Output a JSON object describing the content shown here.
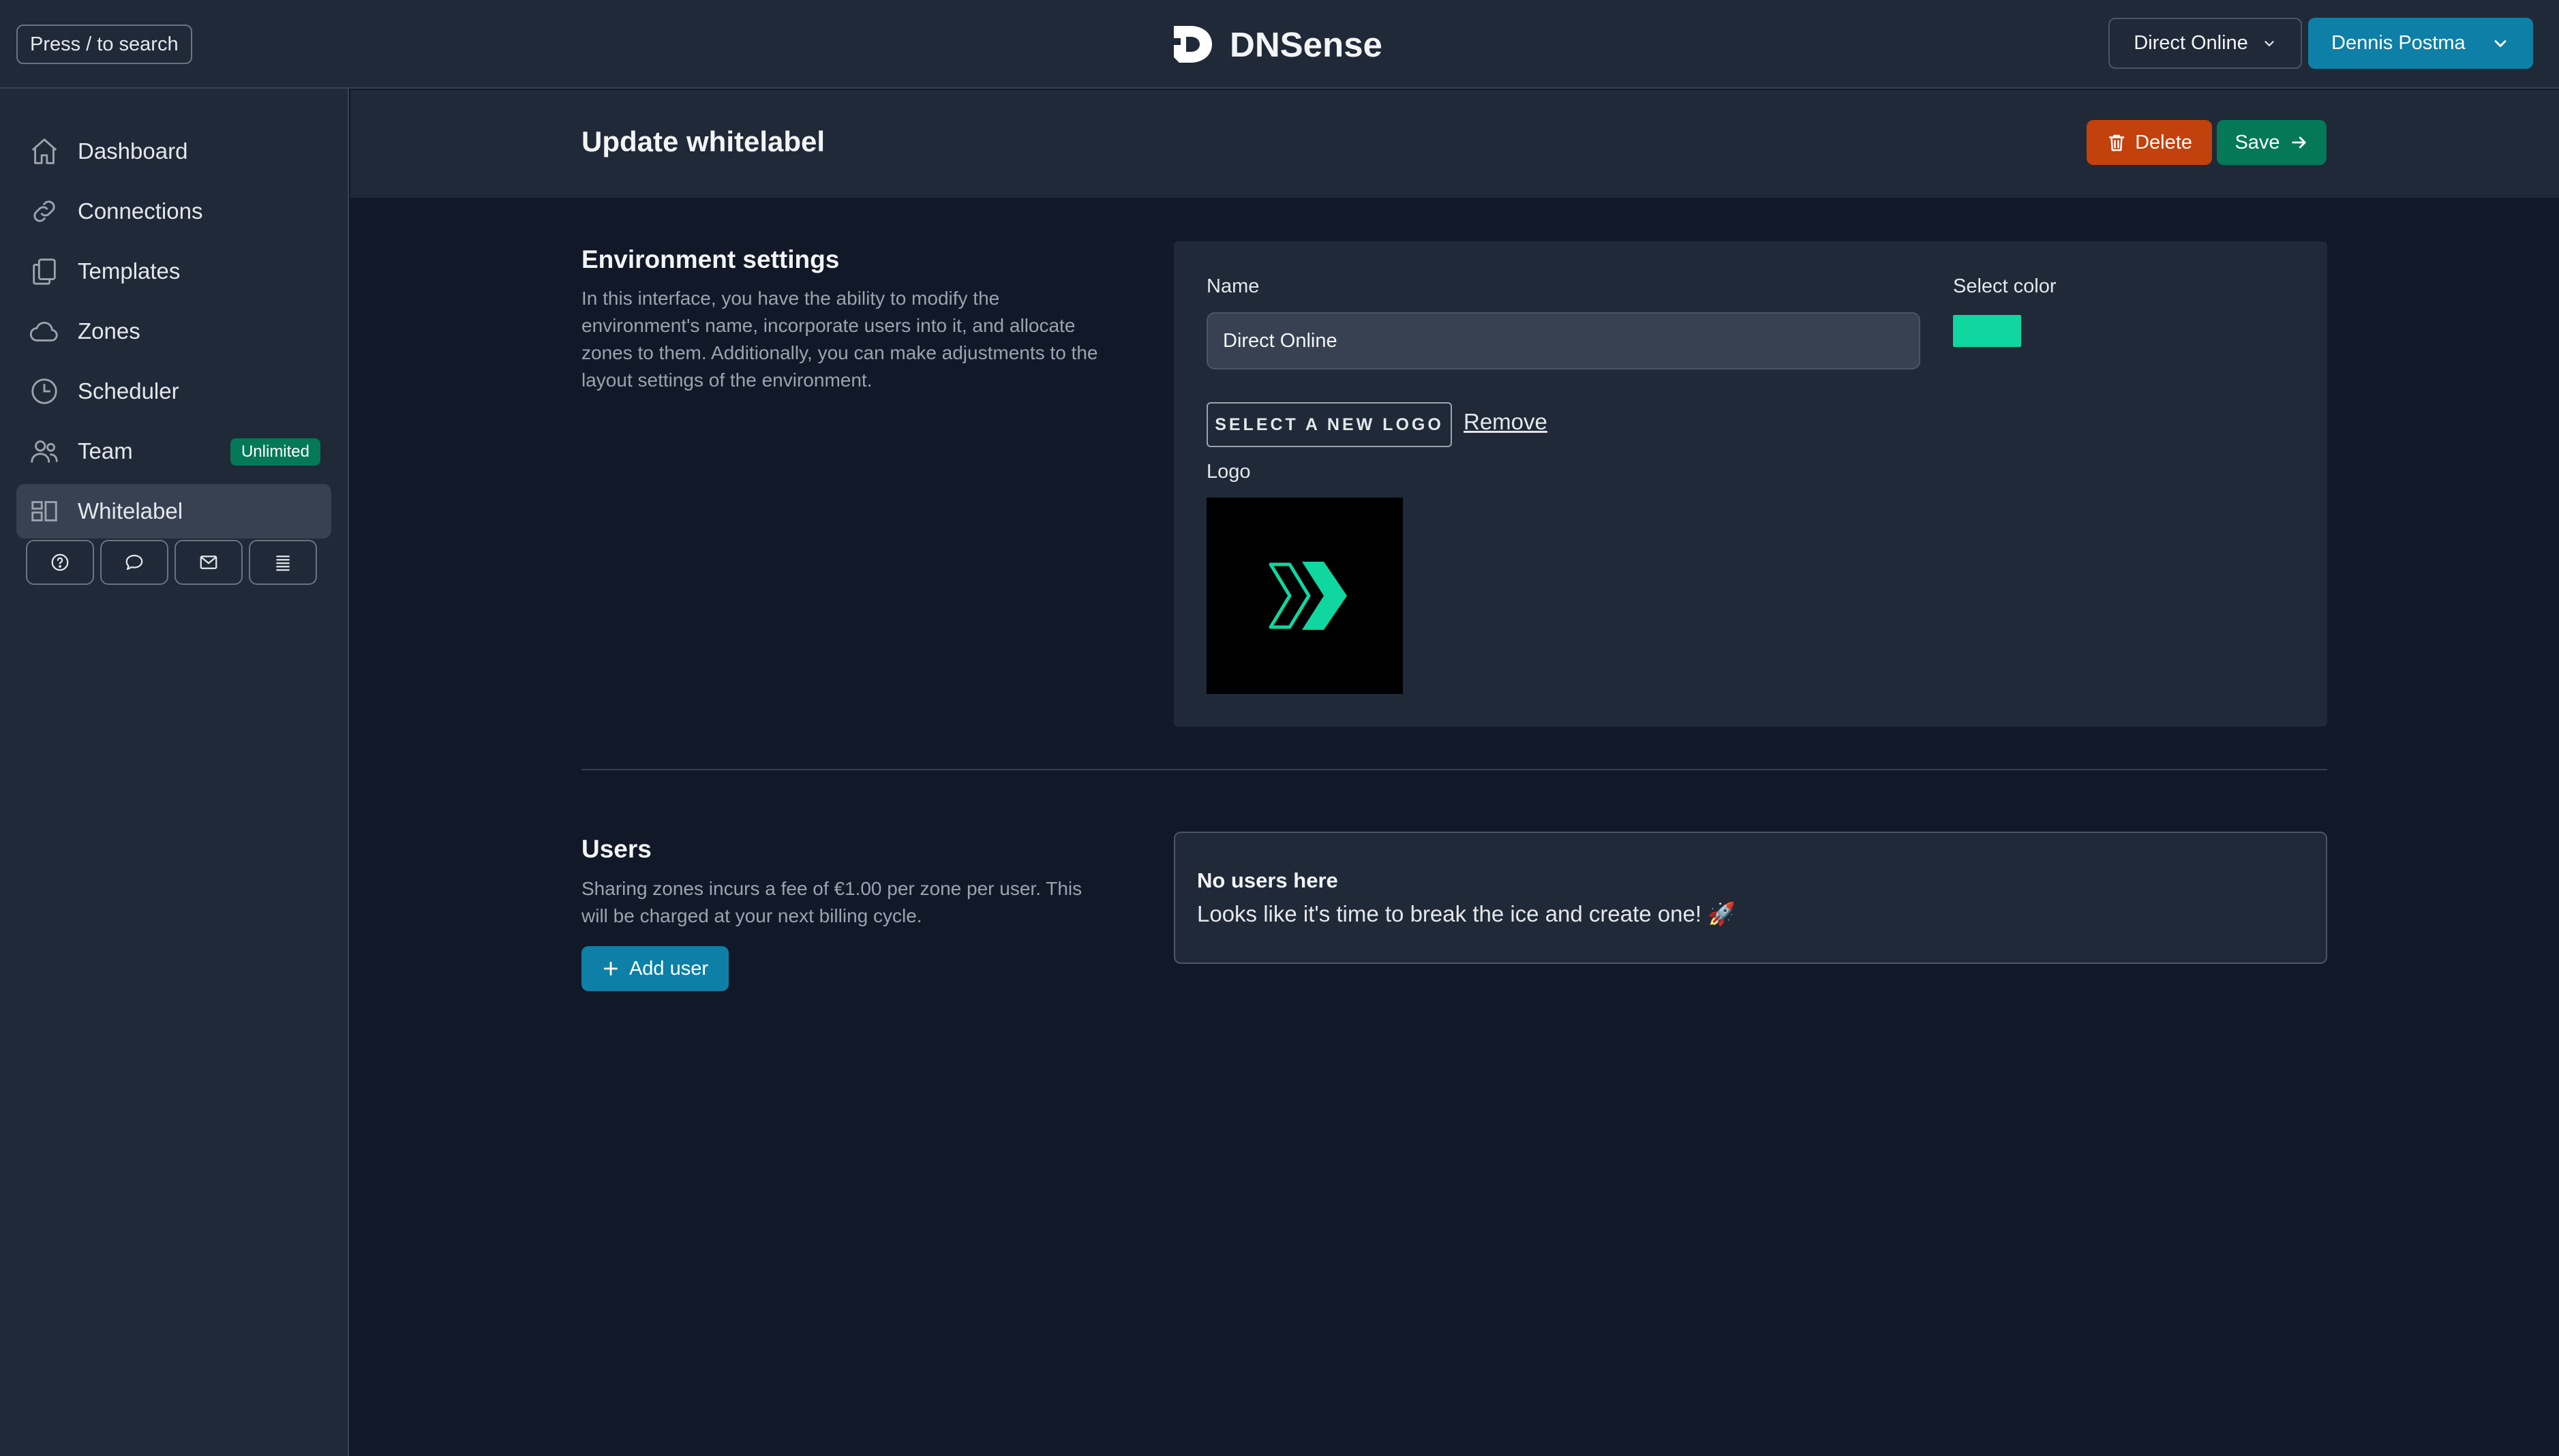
{
  "topbar": {
    "search_label": "Press / to search",
    "brand_name": "DNSense",
    "environment_select": "Direct Online",
    "user_name": "Dennis Postma"
  },
  "sidebar": {
    "items": [
      {
        "label": "Dashboard",
        "icon": "home-icon"
      },
      {
        "label": "Connections",
        "icon": "link-icon"
      },
      {
        "label": "Templates",
        "icon": "documents-icon"
      },
      {
        "label": "Zones",
        "icon": "cloud-icon"
      },
      {
        "label": "Scheduler",
        "icon": "clock-icon"
      },
      {
        "label": "Team",
        "icon": "users-icon",
        "badge": "Unlimited"
      },
      {
        "label": "Whitelabel",
        "icon": "layout-icon",
        "active": true
      }
    ],
    "utility_icons": [
      "help-icon",
      "chat-icon",
      "mail-icon",
      "list-icon"
    ]
  },
  "page": {
    "title": "Update whitelabel",
    "delete_label": "Delete",
    "save_label": "Save"
  },
  "environment": {
    "title": "Environment settings",
    "description_lines": [
      "In this interface, you have the ability to modify the",
      "environment's name, incorporate users into it, and allocate",
      "zones to them. Additionally, you can make adjustments to the",
      "layout settings of the environment."
    ],
    "name_label": "Name",
    "name_value": "Direct Online",
    "color_label": "Select color",
    "color_value": "#10d6a0",
    "select_logo_label": "SELECT A NEW LOGO",
    "remove_label": "Remove",
    "logo_label": "Logo"
  },
  "users": {
    "title": "Users",
    "description_lines": [
      "Sharing zones incurs a fee of €1.00 per zone per user. This",
      "will be charged at your next billing cycle."
    ],
    "add_user_label": "Add user",
    "empty_title": "No users here",
    "empty_text": "Looks like it's time to break the ice and create one! 🚀"
  },
  "colors": {
    "background": "#111827",
    "panel": "#1f2937",
    "primary": "#0e7fa6",
    "success": "#047857",
    "danger": "#c2410c",
    "accent": "#10d6a0"
  }
}
